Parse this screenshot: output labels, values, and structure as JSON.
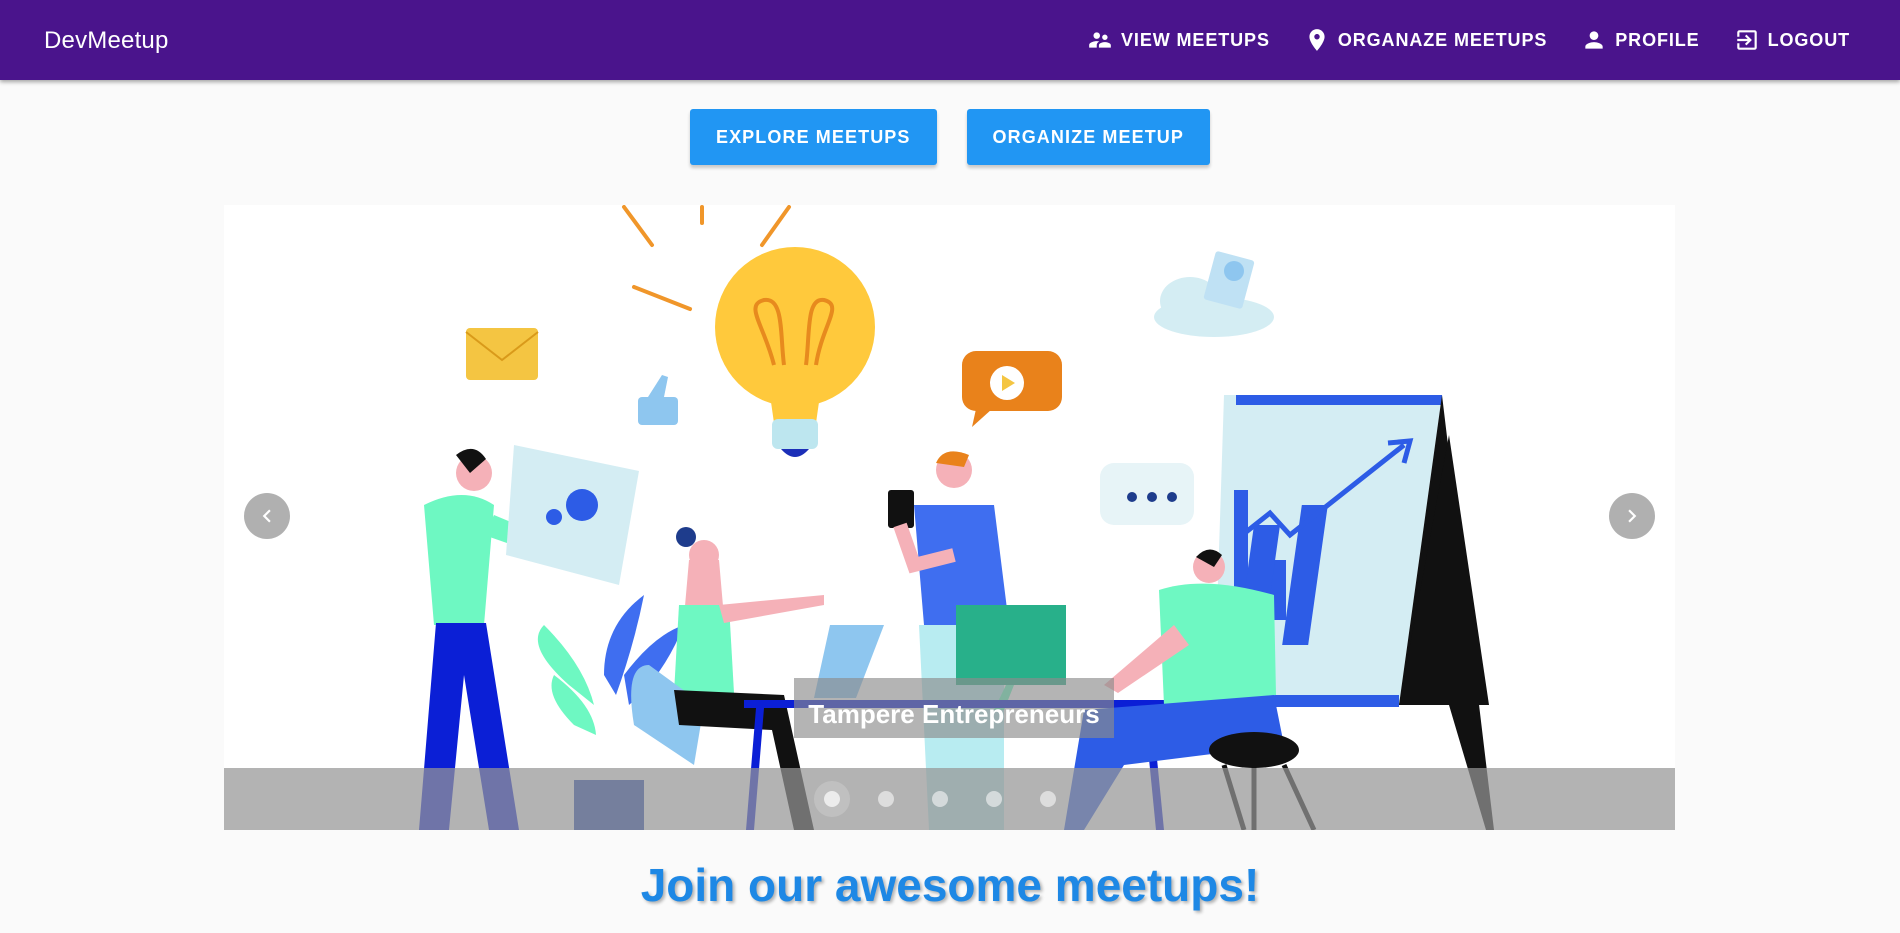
{
  "header": {
    "brand": "DevMeetup",
    "nav": [
      {
        "label": "VIEW MEETUPS",
        "icon": "supervisor-account-icon"
      },
      {
        "label": "ORGANAZE MEETUPS",
        "icon": "location-pin-icon"
      },
      {
        "label": "PROFILE",
        "icon": "person-icon"
      },
      {
        "label": "LOGOUT",
        "icon": "exit-to-app-icon"
      }
    ]
  },
  "actions": {
    "explore_label": "EXPLORE MEETUPS",
    "organize_label": "ORGANIZE MEETUP"
  },
  "carousel": {
    "caption": "Tampere Entrepreneurs",
    "slide_count": 5,
    "active_slide": 1,
    "prev_icon": "chevron-left-icon",
    "next_icon": "chevron-right-icon"
  },
  "headline": "Join our awesome meetups!",
  "colors": {
    "toolbar": "#4a148c",
    "button": "#2196f3",
    "headline": "#1e88e5"
  }
}
